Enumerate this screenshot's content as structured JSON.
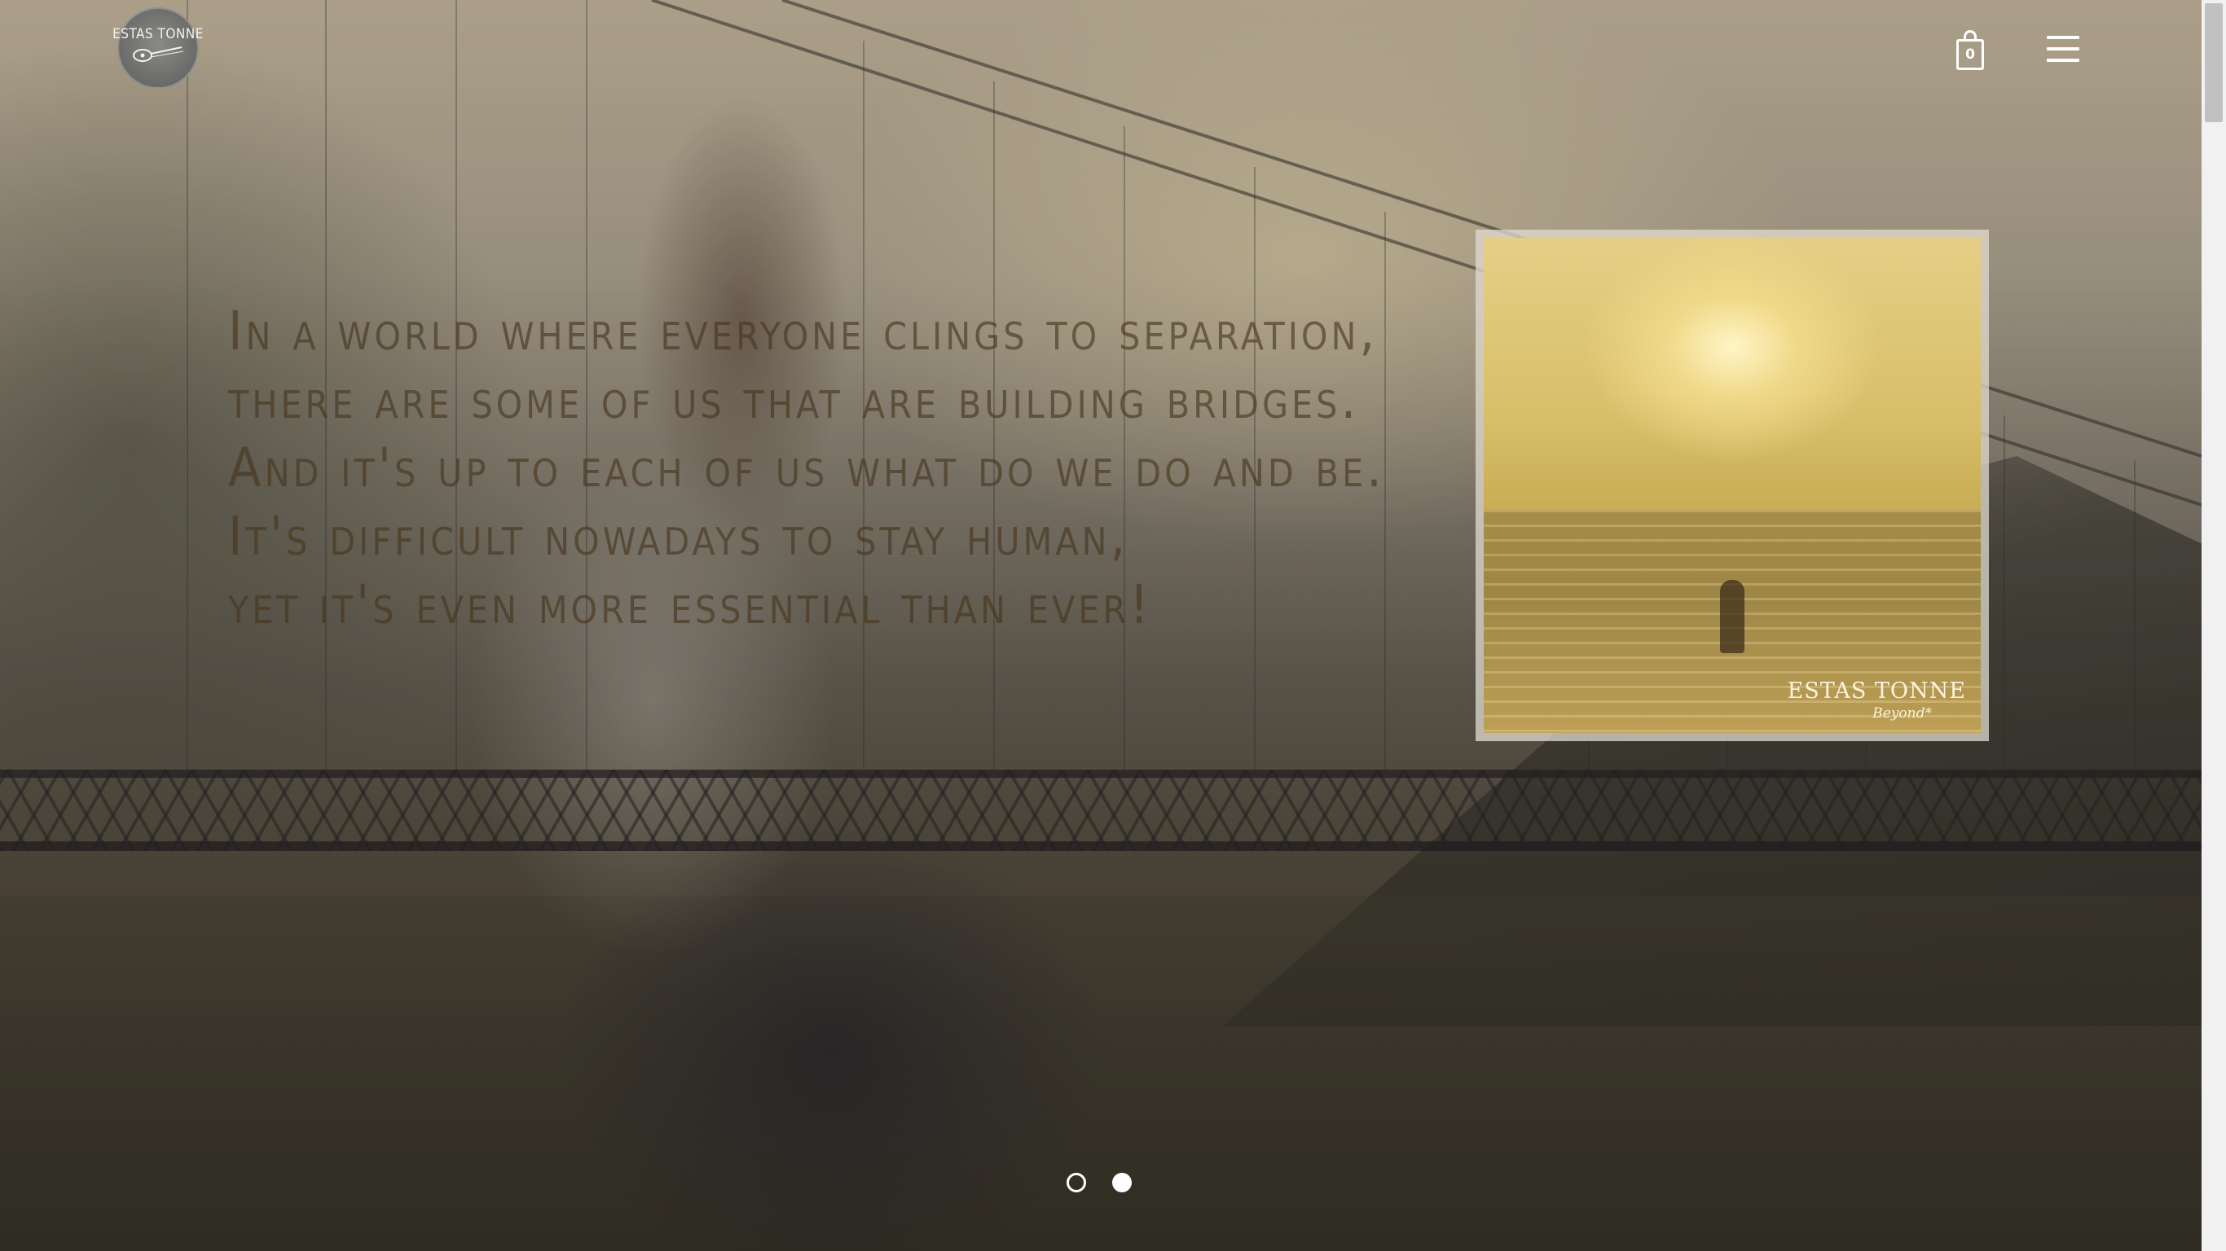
{
  "header": {
    "logo_text": "ESTAS TONNE",
    "cart_count": "0",
    "icons": {
      "cart": "shopping-bag-icon",
      "menu": "hamburger-menu-icon",
      "logo": "guitar-logo-icon"
    }
  },
  "hero": {
    "quote_lines": [
      "In a world where everyone clings to separation,",
      "there are some of us that are building bridges.",
      "And it's up to each of us what do we do and be.",
      "It's difficult nowadays to stay human,",
      "yet it's even more essential than ever!"
    ],
    "quote_color": "#46341c"
  },
  "album": {
    "title": "ESTAS TONNE",
    "subtitle": "Beyond*"
  },
  "slider": {
    "total_slides": 2,
    "active_slide": 2
  },
  "colors": {
    "icon_white": "#ffffff",
    "album_frame": "#e1dcd2",
    "scrollbar_track": "#f1f1f1",
    "scrollbar_thumb": "#c1c1c1"
  }
}
